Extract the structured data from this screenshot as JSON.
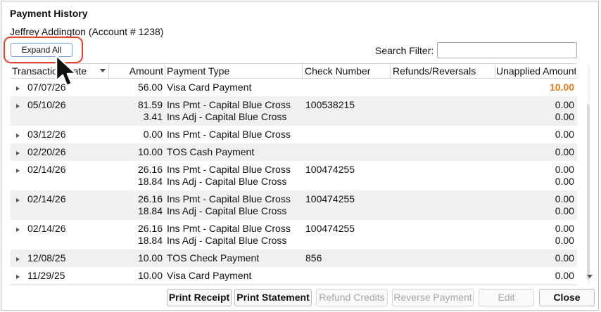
{
  "window": {
    "title": "Payment History",
    "account": "Jeffrey Addington (Account # 1238)"
  },
  "toolbar": {
    "expand_all_label": "Expand All",
    "search_label": "Search Filter:",
    "search_value": ""
  },
  "table": {
    "columns": [
      "Transaction Date",
      "Amount",
      "Payment Type",
      "Check Number",
      "Refunds/Reversals",
      "Unapplied Amount"
    ],
    "rows": [
      {
        "date": "07/07/26",
        "lines": [
          {
            "amount": "56.00",
            "type": "Visa Card Payment",
            "check": "",
            "unapplied": "10.00"
          }
        ],
        "highlight_unapplied": true
      },
      {
        "date": "05/10/26",
        "lines": [
          {
            "amount": "81.59",
            "type": "Ins Pmt - Capital Blue Cross",
            "check": "100538215",
            "unapplied": "0.00"
          },
          {
            "amount": "3.41",
            "type": "Ins Adj - Capital Blue Cross",
            "check": "",
            "unapplied": "0.00"
          }
        ]
      },
      {
        "date": "03/12/26",
        "lines": [
          {
            "amount": "0.00",
            "type": "Ins Pmt - Capital Blue Cross",
            "check": "",
            "unapplied": "0.00"
          }
        ]
      },
      {
        "date": "02/20/26",
        "lines": [
          {
            "amount": "10.00",
            "type": "TOS Cash Payment",
            "check": "",
            "unapplied": "0.00"
          }
        ]
      },
      {
        "date": "02/14/26",
        "lines": [
          {
            "amount": "26.16",
            "type": "Ins Pmt - Capital Blue Cross",
            "check": "100474255",
            "unapplied": "0.00"
          },
          {
            "amount": "18.84",
            "type": "Ins Adj - Capital Blue Cross",
            "check": "",
            "unapplied": "0.00"
          }
        ]
      },
      {
        "date": "02/14/26",
        "lines": [
          {
            "amount": "26.16",
            "type": "Ins Pmt - Capital Blue Cross",
            "check": "100474255",
            "unapplied": "0.00"
          },
          {
            "amount": "18.84",
            "type": "Ins Adj - Capital Blue Cross",
            "check": "",
            "unapplied": "0.00"
          }
        ]
      },
      {
        "date": "02/14/26",
        "lines": [
          {
            "amount": "26.16",
            "type": "Ins Pmt - Capital Blue Cross",
            "check": "100474255",
            "unapplied": "0.00"
          },
          {
            "amount": "18.84",
            "type": "Ins Adj - Capital Blue Cross",
            "check": "",
            "unapplied": "0.00"
          }
        ]
      },
      {
        "date": "12/08/25",
        "lines": [
          {
            "amount": "10.00",
            "type": "TOS Check Payment",
            "check": "856",
            "unapplied": "0.00"
          }
        ]
      },
      {
        "date": "11/29/25",
        "lines": [
          {
            "amount": "10.00",
            "type": "Visa Card Payment",
            "check": "",
            "unapplied": "0.00"
          }
        ]
      }
    ]
  },
  "buttons": {
    "print_receipt": "Print Receipt",
    "print_statement": "Print Statement",
    "refund_credits": "Refund Credits",
    "reverse_payment": "Reverse Payment",
    "edit": "Edit",
    "close": "Close"
  },
  "colors": {
    "highlight_ring": "#e8432c",
    "unapplied_positive": "#e9781f"
  }
}
